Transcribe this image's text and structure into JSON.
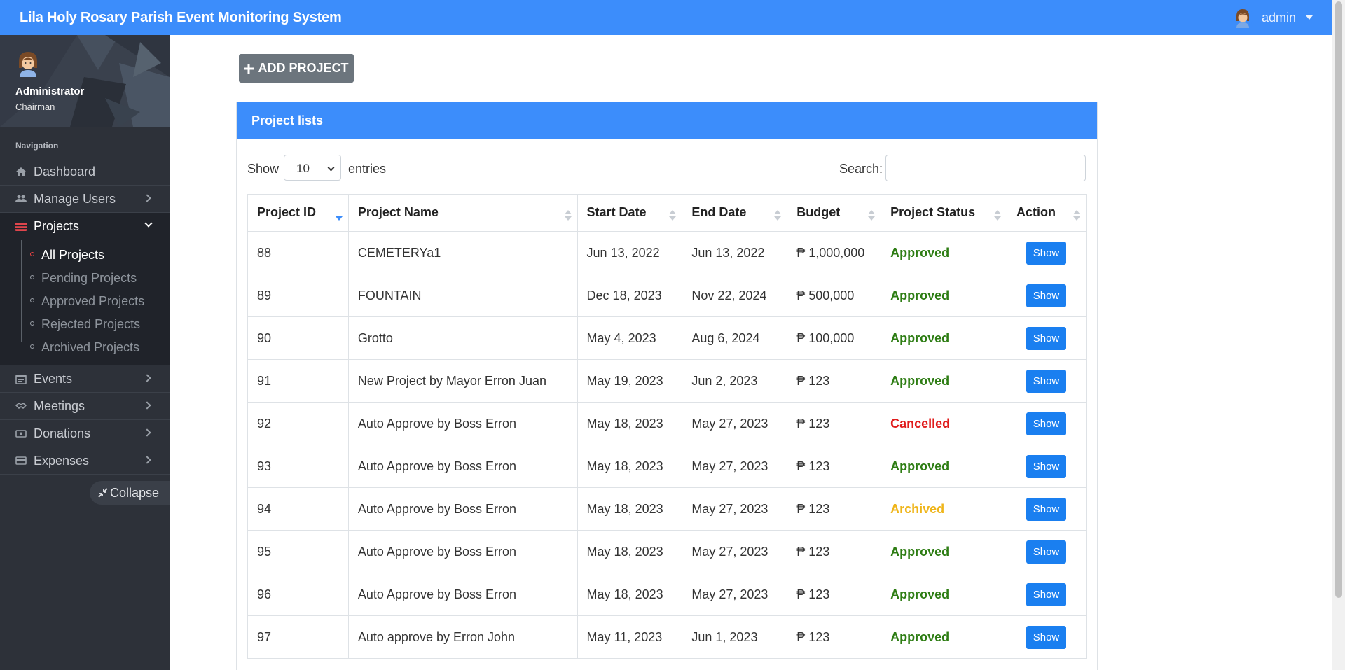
{
  "app": {
    "title": "Lila Holy Rosary Parish Event Monitoring System",
    "user": "admin"
  },
  "profile": {
    "name": "Administrator",
    "role": "Chairman"
  },
  "sidebar": {
    "heading": "Navigation",
    "items": [
      {
        "label": "Dashboard",
        "icon": "home-icon"
      },
      {
        "label": "Manage Users",
        "icon": "users-icon"
      },
      {
        "label": "Projects",
        "icon": "projects-icon"
      },
      {
        "label": "Events",
        "icon": "calendar-icon"
      },
      {
        "label": "Meetings",
        "icon": "handshake-icon"
      },
      {
        "label": "Donations",
        "icon": "money-icon"
      },
      {
        "label": "Expenses",
        "icon": "card-icon"
      }
    ],
    "projects_sub": [
      "All Projects",
      "Pending Projects",
      "Approved Projects",
      "Rejected Projects",
      "Archived Projects"
    ],
    "collapse_label": "Collapse"
  },
  "main": {
    "add_button": "ADD PROJECT",
    "card_title": "Project lists",
    "show_label": "Show",
    "entries_value": "10",
    "entries_label": "entries",
    "search_label": "Search:",
    "columns": [
      "Project ID",
      "Project Name",
      "Start Date",
      "End Date",
      "Budget",
      "Project Status",
      "Action"
    ],
    "rows": [
      {
        "id": "88",
        "name": "CEMETERYa1",
        "start": "Jun 13, 2022",
        "end": "Jun 13, 2022",
        "budget": "₱ 1,000,000",
        "status": "Approved",
        "action": "Show"
      },
      {
        "id": "89",
        "name": "FOUNTAIN",
        "start": "Dec 18, 2023",
        "end": "Nov 22, 2024",
        "budget": "₱ 500,000",
        "status": "Approved",
        "action": "Show"
      },
      {
        "id": "90",
        "name": "Grotto",
        "start": "May 4, 2023",
        "end": "Aug 6, 2024",
        "budget": "₱ 100,000",
        "status": "Approved",
        "action": "Show"
      },
      {
        "id": "91",
        "name": "New Project by Mayor Erron Juan",
        "start": "May 19, 2023",
        "end": "Jun 2, 2023",
        "budget": "₱ 123",
        "status": "Approved",
        "action": "Show"
      },
      {
        "id": "92",
        "name": "Auto Approve by Boss Erron",
        "start": "May 18, 2023",
        "end": "May 27, 2023",
        "budget": "₱ 123",
        "status": "Cancelled",
        "action": "Show"
      },
      {
        "id": "93",
        "name": "Auto Approve by Boss Erron",
        "start": "May 18, 2023",
        "end": "May 27, 2023",
        "budget": "₱ 123",
        "status": "Approved",
        "action": "Show"
      },
      {
        "id": "94",
        "name": "Auto Approve by Boss Erron",
        "start": "May 18, 2023",
        "end": "May 27, 2023",
        "budget": "₱ 123",
        "status": "Archived",
        "action": "Show"
      },
      {
        "id": "95",
        "name": "Auto Approve by Boss Erron",
        "start": "May 18, 2023",
        "end": "May 27, 2023",
        "budget": "₱ 123",
        "status": "Approved",
        "action": "Show"
      },
      {
        "id": "96",
        "name": "Auto Approve by Boss Erron",
        "start": "May 18, 2023",
        "end": "May 27, 2023",
        "budget": "₱ 123",
        "status": "Approved",
        "action": "Show"
      },
      {
        "id": "97",
        "name": "Auto approve by Erron John",
        "start": "May 11, 2023",
        "end": "Jun 1, 2023",
        "budget": "₱ 123",
        "status": "Approved",
        "action": "Show"
      }
    ]
  },
  "colors": {
    "accent": "#3c8dfb",
    "sidebar_bg": "#2d3139",
    "approved": "#2e7d14",
    "cancelled": "#e01b1b",
    "archived": "#efb51a",
    "show_button": "#1a7ff0"
  }
}
